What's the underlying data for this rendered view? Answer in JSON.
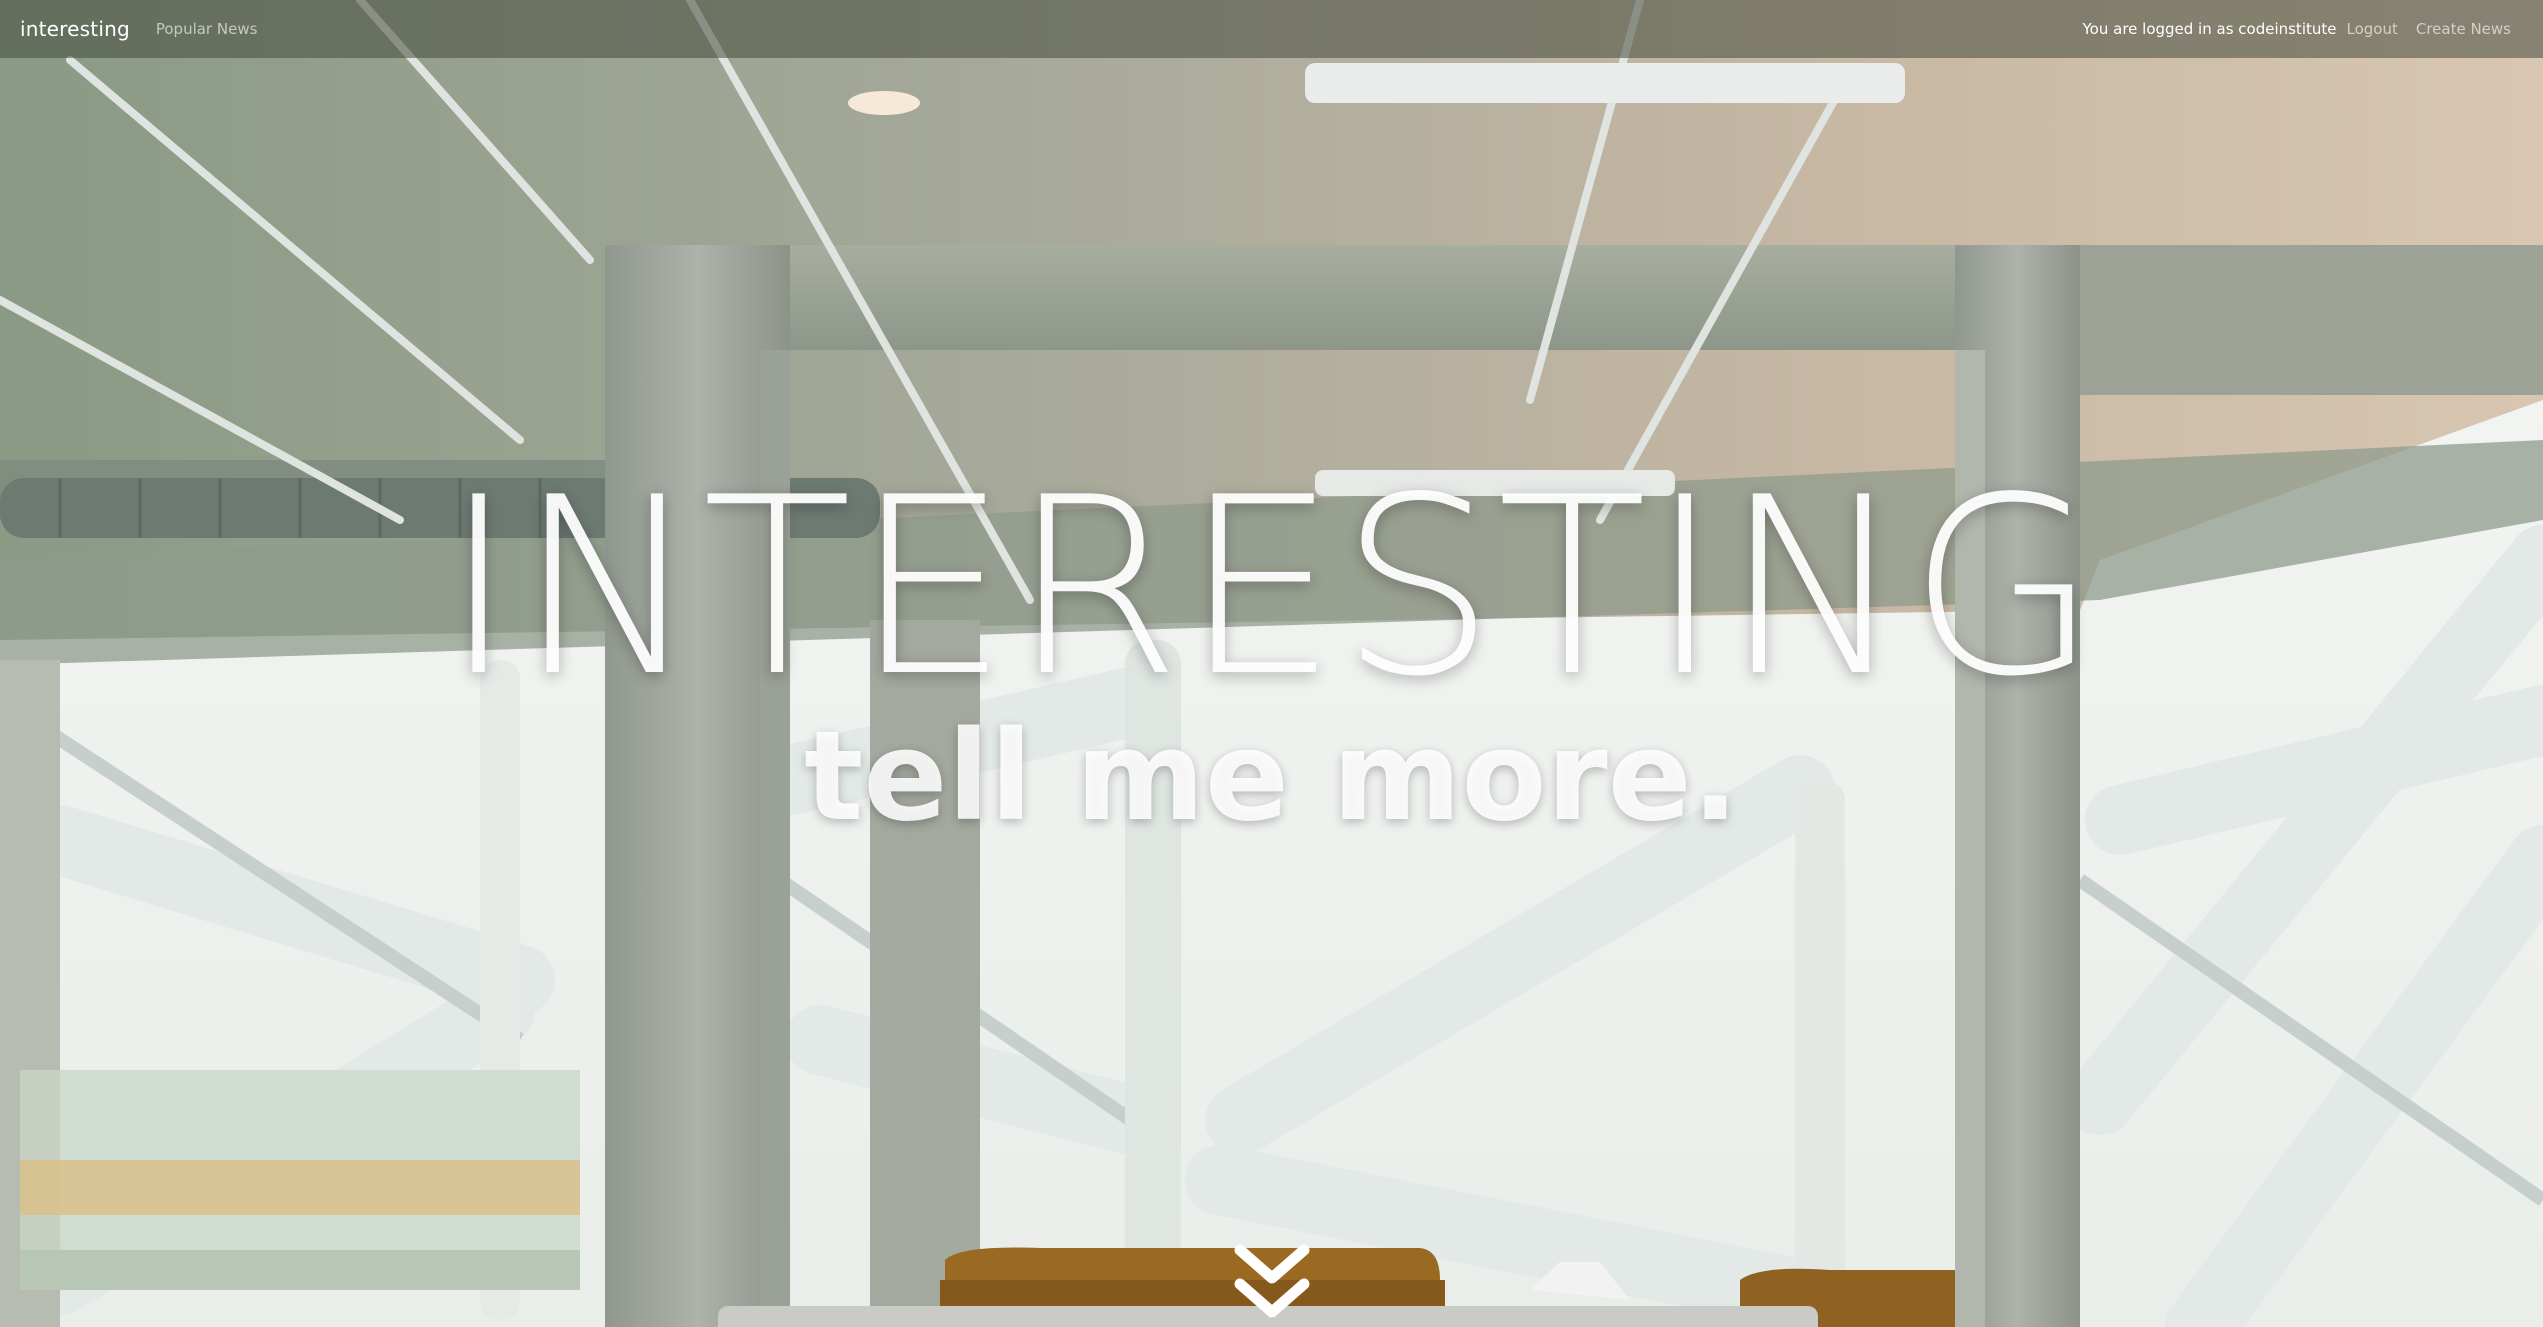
{
  "navbar": {
    "brand": "interesting",
    "popular_news": "Popular News",
    "status_text": "You are logged in as codeinstitute",
    "logout": "Logout",
    "create_news": "Create News"
  },
  "hero": {
    "heading": "INTERESTING",
    "subheading": "tell me more."
  },
  "icons": {
    "scroll": "double-chevron-down-icon"
  },
  "colors": {
    "navbar_bg": "#464a3c",
    "hero_text": "#ffffff"
  }
}
